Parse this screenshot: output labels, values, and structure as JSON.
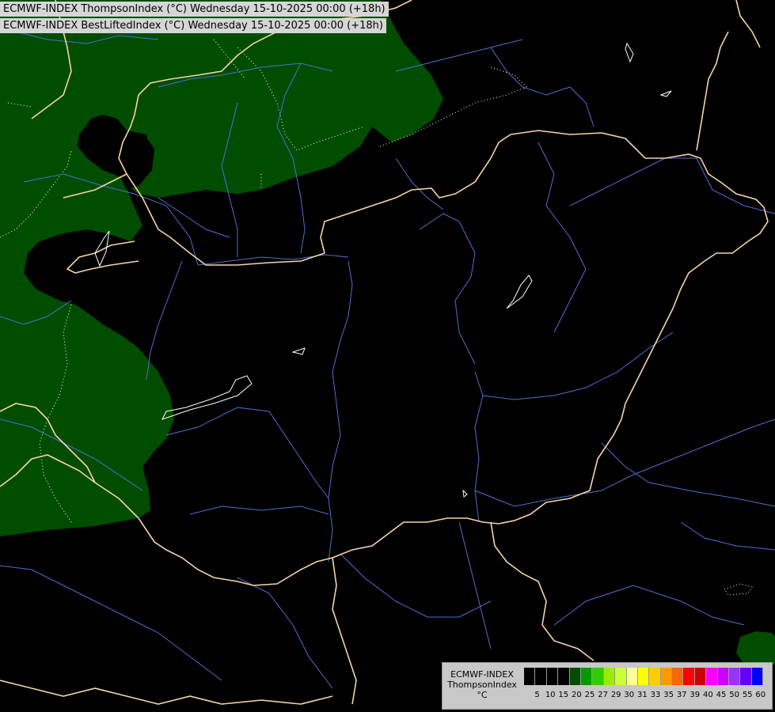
{
  "titles": {
    "line1": "ECMWF-INDEX ThompsonIndex (°C) Wednesday 15-10-2025 00:00 (+18h)",
    "line2": "ECMWF-INDEX BestLiftedIndex (°C) Wednesday 15-10-2025 00:00 (+18h)"
  },
  "legend": {
    "line1": "ECMWF-INDEX",
    "line2": "ThompsonIndex",
    "unit": "°C",
    "ticks": [
      "5",
      "10",
      "15",
      "20",
      "25",
      "27",
      "29",
      "30",
      "31",
      "33",
      "35",
      "37",
      "39",
      "40",
      "45",
      "50",
      "55",
      "60"
    ],
    "colors": [
      "#000000",
      "#000000",
      "#000000",
      "#000000",
      "#004d00",
      "#009900",
      "#33cc00",
      "#99ee00",
      "#ccff33",
      "#ffff99",
      "#ffff00",
      "#ffcc00",
      "#ff9900",
      "#ff6600",
      "#ff0000",
      "#cc0000",
      "#ff00ff",
      "#cc00ff",
      "#9933ff",
      "#6600ff",
      "#0000ff"
    ]
  },
  "map_colors": {
    "background": "#000000",
    "thompson_fill": "#004d00",
    "borders": "#f5d5a8",
    "rivers": "#4f6fd0",
    "lakes": "#ffffff",
    "contours": "#ffffff"
  }
}
